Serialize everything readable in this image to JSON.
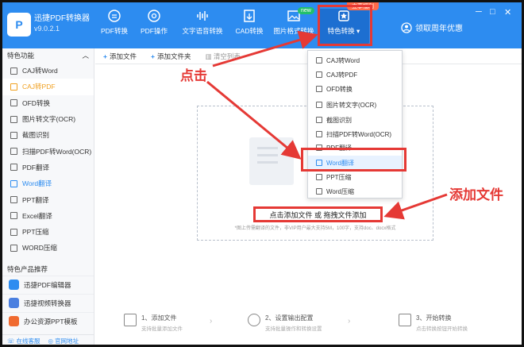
{
  "app": {
    "name": "迅捷PDF转换器",
    "version": "v9.0.2.1",
    "logo_text": "P"
  },
  "nav": [
    {
      "label": "PDF转换",
      "icon": "pdf-convert-icon"
    },
    {
      "label": "PDF操作",
      "icon": "pdf-ops-icon"
    },
    {
      "label": "文字语音转换",
      "icon": "voice-icon"
    },
    {
      "label": "CAD转换",
      "icon": "cad-icon"
    },
    {
      "label": "图片格式转换",
      "icon": "image-icon"
    },
    {
      "label": "特色转换",
      "icon": "feature-icon"
    }
  ],
  "nav_badge": "new",
  "promo_top": "立享福利",
  "user_button": "领取周年优惠",
  "window_controls": [
    "─",
    "□",
    "✕"
  ],
  "sidebar": {
    "title": "特色功能",
    "collapse": "︿",
    "items": [
      "CAJ转Word",
      "CAJ转PDF",
      "OFD转换",
      "图片转文字(OCR)",
      "截图识别",
      "扫描PDF转Word(OCR)",
      "PDF翻译",
      "Word翻译",
      "PPT翻译",
      "Excel翻译",
      "PPT压缩",
      "WORD压缩"
    ],
    "products_title": "特色产品推荐",
    "products": [
      "迅捷PDF编辑器",
      "迅捷视频转换器",
      "办公资源PPT模板"
    ],
    "footer": [
      "在线客服",
      "官网地址"
    ]
  },
  "toolbar": {
    "add_file": "添加文件",
    "add_folder": "添加文件夹",
    "clear": "清空列表"
  },
  "dropzone": {
    "button": "点击添加文件 或 拖拽文件添加",
    "hint": "*图上传需翻译的文件，非VIP用户最大支持5M，100字，支持doc、docx格式"
  },
  "steps": [
    {
      "title": "1、添加文件",
      "sub": "支持批量添加文件"
    },
    {
      "title": "2、设置输出配置",
      "sub": "支持批量操作和转换设置"
    },
    {
      "title": "3、开始转换",
      "sub": "点击转换按钮开始转换"
    }
  ],
  "dropdown": [
    "CAJ转Word",
    "CAJ转PDF",
    "OFD转换",
    "图片转文字(OCR)",
    "截图识别",
    "扫描PDF转Word(OCR)",
    "PDF翻译",
    "Word翻译",
    "PPT压缩",
    "Word压缩"
  ],
  "annotations": {
    "click": "点击",
    "add_file": "添加文件"
  },
  "colors": {
    "brand": "#2d8cf0",
    "annotation": "#e53935",
    "active": "#f0a020"
  }
}
